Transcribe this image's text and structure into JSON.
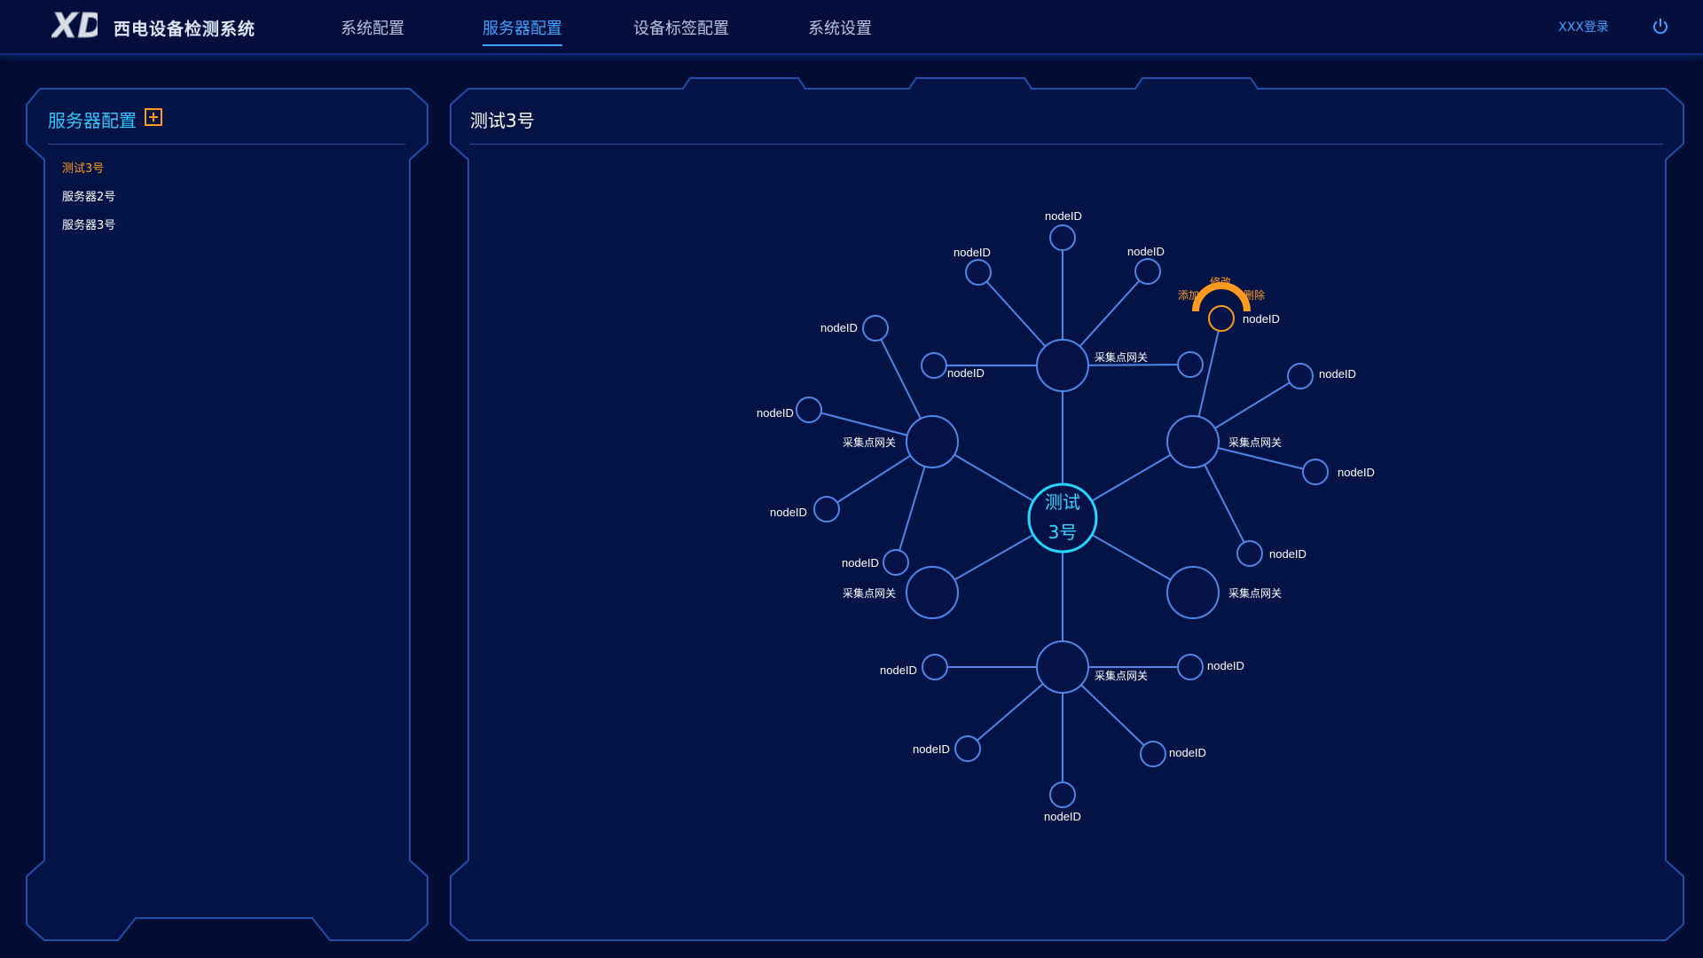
{
  "app": {
    "title": "西电设备检测系统",
    "logo_text": "XD"
  },
  "nav": [
    {
      "label": "系统配置",
      "active": false
    },
    {
      "label": "服务器配置",
      "active": true
    },
    {
      "label": "设备标签配置",
      "active": false
    },
    {
      "label": "系统设置",
      "active": false
    }
  ],
  "header": {
    "login": "XXX登录"
  },
  "sidebar": {
    "title": "服务器配置",
    "items": [
      {
        "label": "测试3号",
        "selected": true
      },
      {
        "label": "服务器2号",
        "selected": false
      },
      {
        "label": "服务器3号",
        "selected": false
      }
    ]
  },
  "main": {
    "title": "测试3号"
  },
  "topology": {
    "center_line1": "测试",
    "center_line2": "3号",
    "gateway_label": "采集点网关",
    "node_label": "nodeID",
    "context_menu": {
      "add": "添加",
      "edit": "修改",
      "delete": "删除"
    }
  },
  "colors": {
    "background": "#030c33",
    "accent": "#3fa2ff",
    "highlight": "#ff9a1f",
    "link": "#4d86e6",
    "center": "#22d8ff"
  }
}
